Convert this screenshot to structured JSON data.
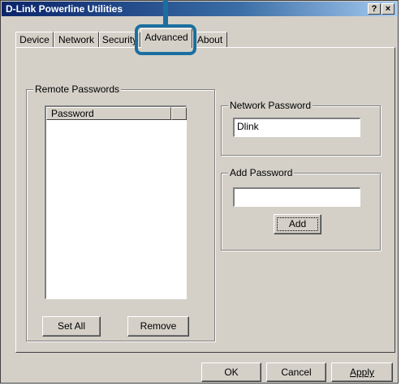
{
  "window": {
    "title": "D-Link Powerline Utilities",
    "help_button": "?",
    "close_button": "×"
  },
  "tabs": [
    {
      "label": "Device",
      "active": false
    },
    {
      "label": "Network",
      "active": false
    },
    {
      "label": "Security",
      "active": false
    },
    {
      "label": "Advanced",
      "active": true
    },
    {
      "label": "About",
      "active": false
    }
  ],
  "remote_passwords": {
    "group_label": "Remote Passwords",
    "column_header": "Password",
    "set_all_button": "Set All",
    "remove_button": "Remove"
  },
  "network_password": {
    "group_label": "Network Password",
    "value": "Dlink"
  },
  "add_password": {
    "group_label": "Add Password",
    "value": "",
    "add_button": "Add"
  },
  "footer": {
    "ok_button": "OK",
    "cancel_button": "Cancel",
    "apply_button": "Apply"
  },
  "colors": {
    "title_gradient_start": "#0a246a",
    "dialog_face": "#d4d0c8",
    "callout": "#1a6fa0"
  }
}
